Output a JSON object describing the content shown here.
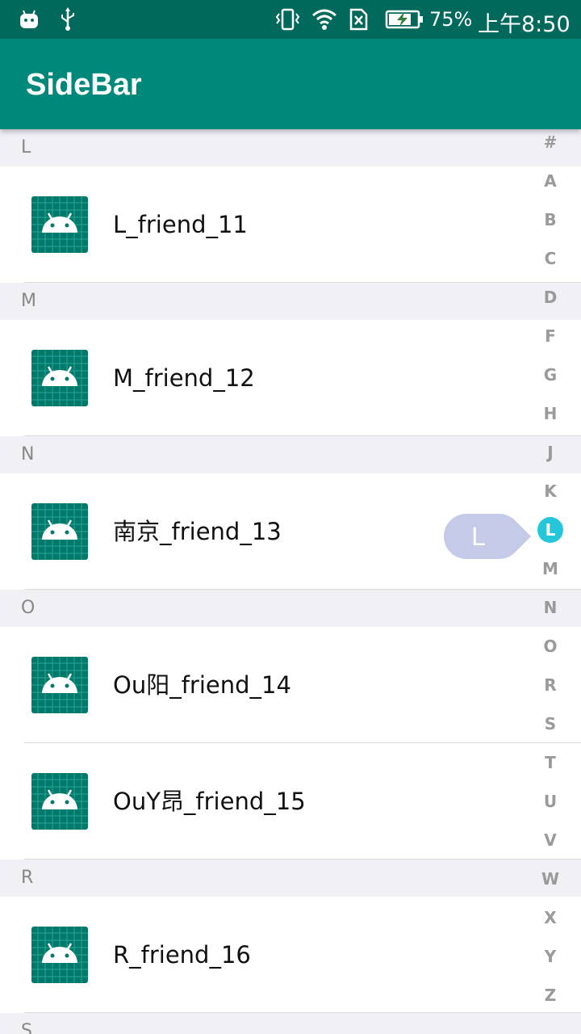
{
  "status_bar": {
    "battery": "75%",
    "time": "上午8:50",
    "icons": [
      "android-notification-icon",
      "usb-icon",
      "vibrate-icon",
      "wifi-icon",
      "no-sim-icon",
      "battery-charging-icon"
    ]
  },
  "app_bar": {
    "title": "SideBar"
  },
  "list": {
    "sections": [
      {
        "header": "L",
        "items": [
          "L_friend_11"
        ]
      },
      {
        "header": "M",
        "items": [
          "M_friend_12"
        ]
      },
      {
        "header": "N",
        "items": [
          "南京_friend_13"
        ]
      },
      {
        "header": "O",
        "items": [
          "Ou阳_friend_14",
          "OuY昂_friend_15"
        ]
      },
      {
        "header": "R",
        "items": [
          "R_friend_16"
        ]
      },
      {
        "header": "S",
        "items": []
      }
    ]
  },
  "index_bar": {
    "letters": [
      "#",
      "A",
      "B",
      "C",
      "D",
      "F",
      "G",
      "H",
      "J",
      "K",
      "L",
      "M",
      "N",
      "O",
      "R",
      "S",
      "T",
      "U",
      "V",
      "W",
      "X",
      "Y",
      "Z"
    ],
    "selected": "L"
  },
  "bubble": {
    "letter": "L"
  },
  "colors": {
    "status_bar": "#00695c",
    "app_bar": "#00897b",
    "avatar_bg": "#00796b",
    "section_bg": "#f0f0f5",
    "selected_index": "#26c6da",
    "bubble": "#c5cae9"
  }
}
